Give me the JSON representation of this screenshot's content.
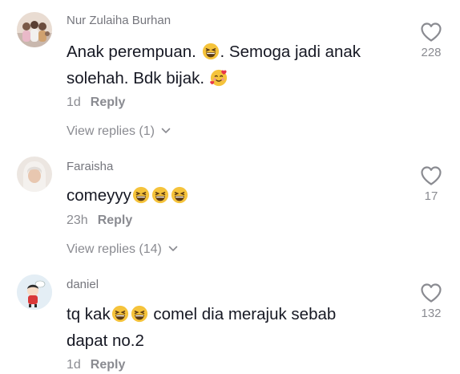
{
  "comments": [
    {
      "username": "Nur Zulaiha Burhan",
      "line1_a": "Anak perempuan.",
      "line1_b": ". Semoga jadi anak",
      "line2": "solehah. Bdk bijak.",
      "time": "1d",
      "reply_label": "Reply",
      "view_replies": "View replies (1)",
      "likes": "228"
    },
    {
      "username": "Faraisha",
      "line1_a": "comeyyy",
      "time": "23h",
      "reply_label": "Reply",
      "view_replies": "View replies (14)",
      "likes": "17"
    },
    {
      "username": "daniel",
      "line1_a": "tq kak",
      "line1_b": " comel dia merajuk sebab",
      "line2": "dapat no.2",
      "time": "1d",
      "reply_label": "Reply",
      "likes": "132"
    }
  ],
  "colors": {
    "muted": "#8a8b91",
    "text": "#161823",
    "emoji_yellow": "#f5c33b"
  },
  "icons": {
    "like": "heart-outline-icon",
    "expand": "chevron-down-icon",
    "laugh": "grinning-squinting-face-emoji",
    "love": "smiling-face-with-hearts-emoji"
  }
}
